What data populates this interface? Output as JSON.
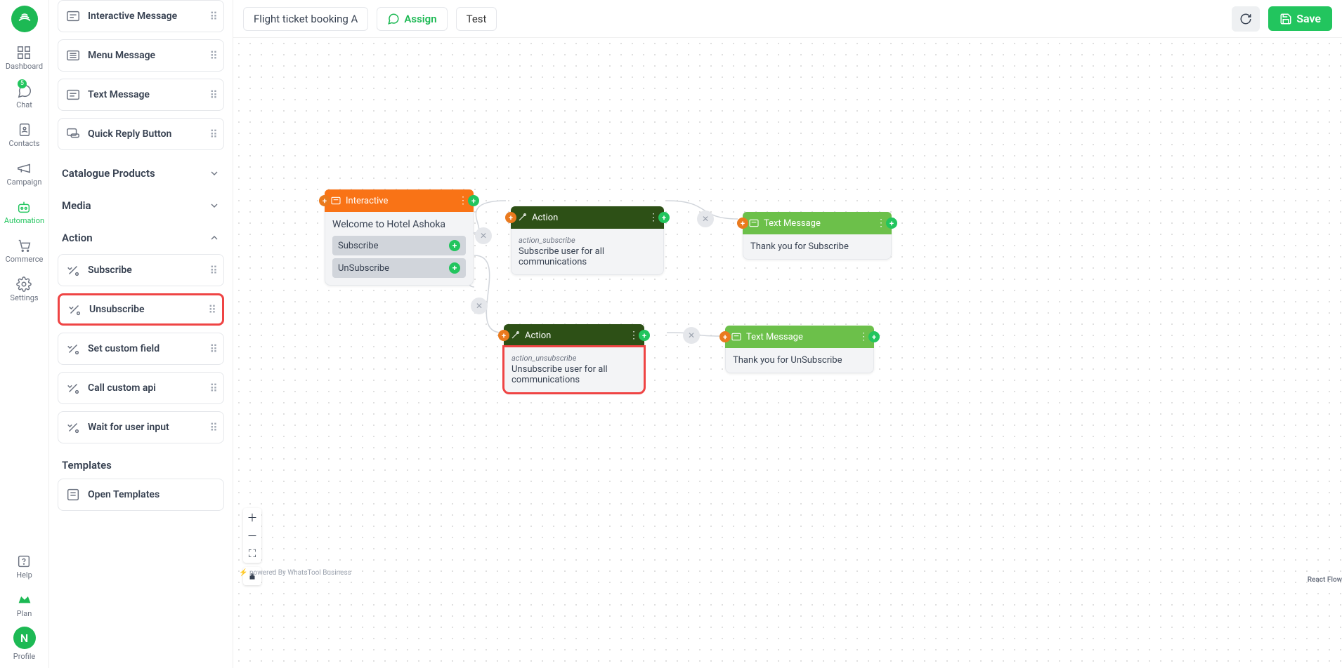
{
  "nav": {
    "items": [
      {
        "id": "dashboard",
        "label": "Dashboard"
      },
      {
        "id": "chat",
        "label": "Chat",
        "badge": "5"
      },
      {
        "id": "contacts",
        "label": "Contacts"
      },
      {
        "id": "campaign",
        "label": "Campaign"
      },
      {
        "id": "automation",
        "label": "Automation",
        "active": true
      },
      {
        "id": "commerce",
        "label": "Commerce"
      },
      {
        "id": "settings",
        "label": "Settings"
      }
    ],
    "bottom": [
      {
        "id": "help",
        "label": "Help"
      },
      {
        "id": "plan",
        "label": "Plan"
      },
      {
        "id": "profile",
        "label": "Profile",
        "avatar": "N"
      }
    ]
  },
  "panel": {
    "message_blocks": [
      {
        "id": "interactive-message",
        "label": "Interactive Message"
      },
      {
        "id": "menu-message",
        "label": "Menu Message"
      },
      {
        "id": "text-message",
        "label": "Text Message"
      },
      {
        "id": "quick-reply",
        "label": "Quick Reply Button"
      }
    ],
    "sections": [
      {
        "id": "catalogue",
        "label": "Catalogue Products",
        "expanded": false
      },
      {
        "id": "media",
        "label": "Media",
        "expanded": false
      },
      {
        "id": "action",
        "label": "Action",
        "expanded": true
      }
    ],
    "action_blocks": [
      {
        "id": "subscribe",
        "label": "Subscribe"
      },
      {
        "id": "unsubscribe",
        "label": "Unsubscribe",
        "selected": true
      },
      {
        "id": "set-custom-field",
        "label": "Set custom field"
      },
      {
        "id": "call-custom-api",
        "label": "Call custom api"
      },
      {
        "id": "wait-for-input",
        "label": "Wait for user input"
      }
    ],
    "templates_header": "Templates",
    "templates_open": "Open Templates"
  },
  "toolbar": {
    "flow_name": "Flight ticket booking A",
    "assign": "Assign",
    "test": "Test",
    "save": "Save"
  },
  "flow": {
    "interactive": {
      "title": "Interactive",
      "message": "Welcome to Hotel Ashoka",
      "options": [
        "Subscribe",
        "UnSubscribe"
      ]
    },
    "action_sub": {
      "title": "Action",
      "slug": "action_subscribe",
      "desc": "Subscribe user for all communications"
    },
    "action_unsub": {
      "title": "Action",
      "slug": "action_unsubscribe",
      "desc": "Unsubscribe user for all communications"
    },
    "text_sub": {
      "title": "Text Message",
      "body": "Thank you for Subscribe"
    },
    "text_unsub": {
      "title": "Text Message",
      "body": "Thank you for UnSubscribe"
    }
  },
  "footer": {
    "powered": "powered By WhatsTool Business",
    "reactflow": "React Flow"
  }
}
